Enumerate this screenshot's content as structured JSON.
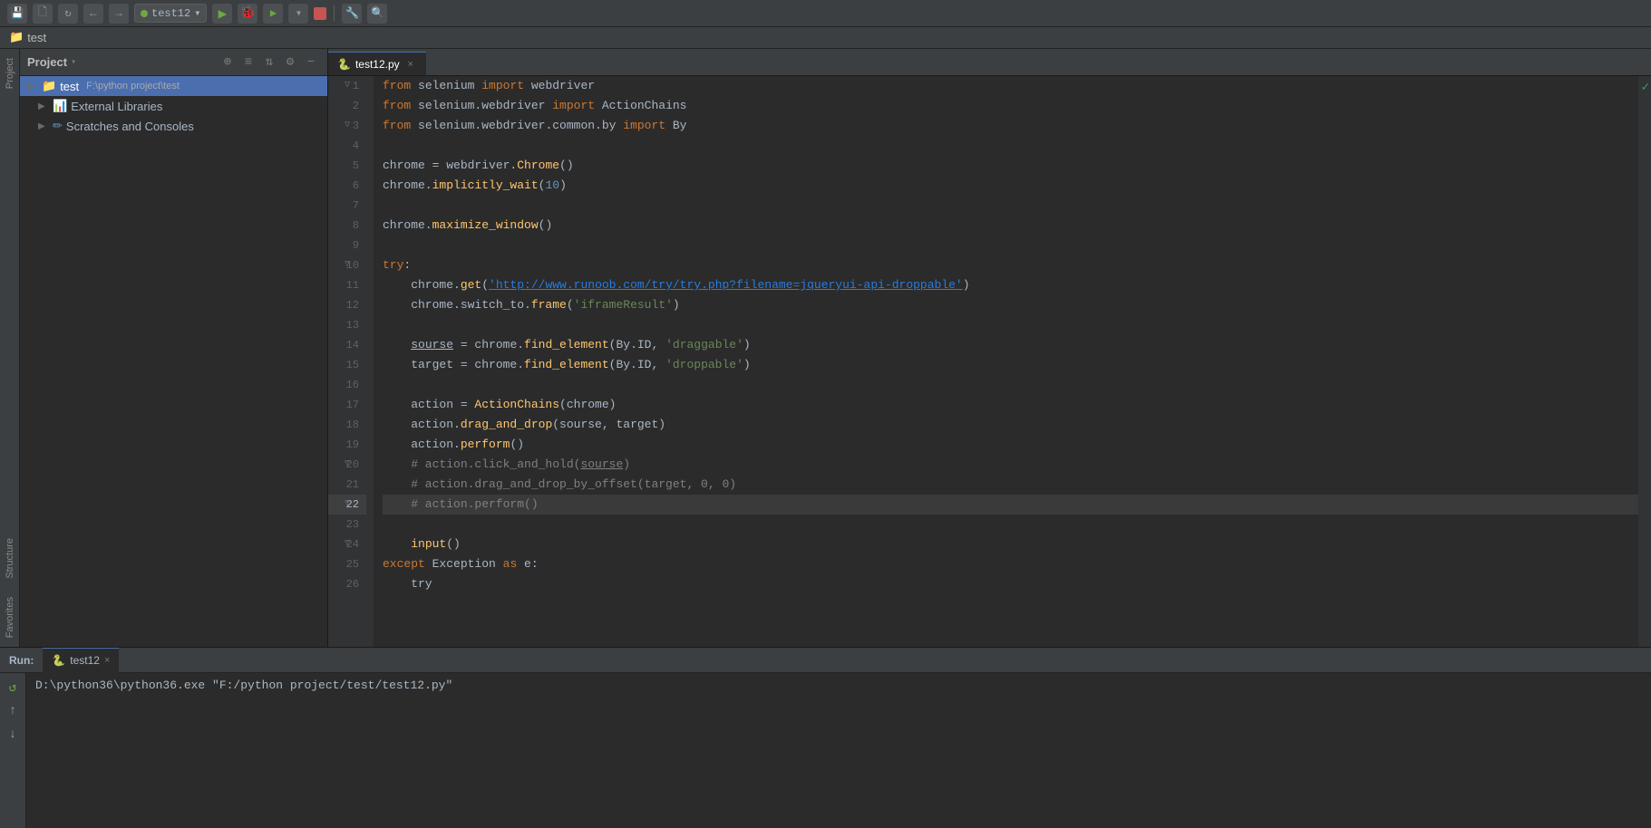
{
  "titlebar": {
    "project_name": "test",
    "run_config": "test12",
    "buttons": [
      "save",
      "back",
      "forward",
      "run_config_dropdown",
      "run",
      "debug",
      "run_coverage",
      "run_stop",
      "settings",
      "search"
    ]
  },
  "window": {
    "title": "test"
  },
  "sidebar": {
    "panel_title": "Project",
    "tree_items": [
      {
        "label": "test",
        "path": "F:\\python project\\test",
        "type": "folder",
        "selected": true
      },
      {
        "label": "External Libraries",
        "type": "libraries"
      },
      {
        "label": "Scratches and Consoles",
        "type": "scratches"
      }
    ]
  },
  "editor": {
    "tab_label": "test12.py",
    "file_icon": "python-file-icon",
    "lines": [
      {
        "num": 1,
        "fold": true,
        "content": "from selenium import webdriver"
      },
      {
        "num": 2,
        "fold": false,
        "content": "from selenium.webdriver import ActionChains"
      },
      {
        "num": 3,
        "fold": true,
        "content": "from selenium.webdriver.common.by import By"
      },
      {
        "num": 4,
        "fold": false,
        "content": ""
      },
      {
        "num": 5,
        "fold": false,
        "content": "chrome = webdriver.Chrome()"
      },
      {
        "num": 6,
        "fold": false,
        "content": "chrome.implicitly_wait(10)"
      },
      {
        "num": 7,
        "fold": false,
        "content": ""
      },
      {
        "num": 8,
        "fold": false,
        "content": "chrome.maximize_window()"
      },
      {
        "num": 9,
        "fold": false,
        "content": ""
      },
      {
        "num": 10,
        "fold": true,
        "content": "try:"
      },
      {
        "num": 11,
        "fold": false,
        "content": "    chrome.get('http://www.runoob.com/try/try.php?filename=jqueryui-api-droppable')"
      },
      {
        "num": 12,
        "fold": false,
        "content": "    chrome.switch_to.frame('iframeResult')"
      },
      {
        "num": 13,
        "fold": false,
        "content": ""
      },
      {
        "num": 14,
        "fold": false,
        "content": "    sourse = chrome.find_element(By.ID, 'draggable')"
      },
      {
        "num": 15,
        "fold": false,
        "content": "    target = chrome.find_element(By.ID, 'droppable')"
      },
      {
        "num": 16,
        "fold": false,
        "content": ""
      },
      {
        "num": 17,
        "fold": false,
        "content": "    action = ActionChains(chrome)"
      },
      {
        "num": 18,
        "fold": false,
        "content": "    action.drag_and_drop(sourse, target)"
      },
      {
        "num": 19,
        "fold": false,
        "content": "    action.perform()"
      },
      {
        "num": 20,
        "fold": true,
        "content": "    # action.click_and_hold(sourse)"
      },
      {
        "num": 21,
        "fold": false,
        "content": "    # action.drag_and_drop_by_offset(target, 0, 0)"
      },
      {
        "num": 22,
        "fold": true,
        "content": "    # action.perform()",
        "highlighted": true
      },
      {
        "num": 23,
        "fold": false,
        "content": ""
      },
      {
        "num": 24,
        "fold": true,
        "content": "    input()"
      },
      {
        "num": 25,
        "fold": false,
        "content": "except Exception as e:"
      },
      {
        "num": 26,
        "fold": false,
        "content": "    try"
      }
    ]
  },
  "run_panel": {
    "label": "Run:",
    "tab_label": "test12",
    "command": "D:\\python36\\python36.exe \"F:/python project/test/test12.py\""
  }
}
